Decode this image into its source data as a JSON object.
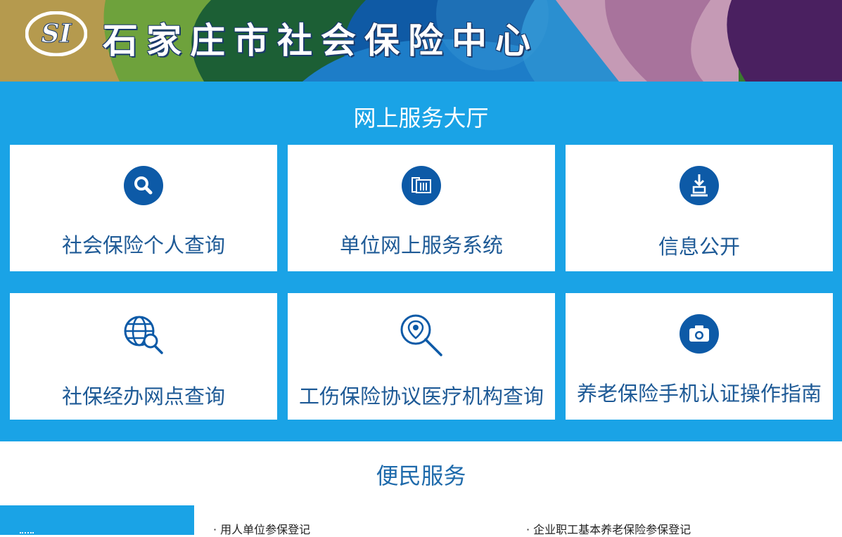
{
  "header": {
    "logo_text": "SI",
    "title": "石家庄市社会保险中心"
  },
  "hall": {
    "title": "网上服务大厅",
    "cards": [
      {
        "label": "社会保险个人查询",
        "icon": "search-icon"
      },
      {
        "label": "单位网上服务系统",
        "icon": "documents-icon"
      },
      {
        "label": "信息公开",
        "icon": "download-tray-icon"
      },
      {
        "label": "社保经办网点查询",
        "icon": "globe-search-icon"
      },
      {
        "label": "工伤保险协议医疗机构查询",
        "icon": "location-search-icon"
      },
      {
        "label": "养老保险手机认证操作指南",
        "icon": "camera-icon"
      }
    ]
  },
  "convenience": {
    "title": "便民服务",
    "links": [
      "· 用人单位参保登记",
      "· 企业职工基本养老保险参保登记"
    ]
  },
  "colors": {
    "hall_bg": "#1aa3e6",
    "icon_bg": "#0d5aa7",
    "card_text": "#1e5a96",
    "section_title": "#1e6aab"
  }
}
